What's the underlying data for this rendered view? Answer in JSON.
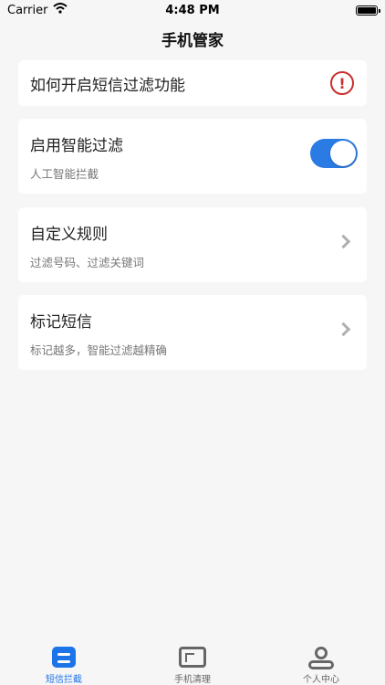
{
  "status_bar": {
    "carrier": "Carrier",
    "time": "4:48 PM"
  },
  "header": {
    "title": "手机管家"
  },
  "cards": [
    {
      "title": "如何开启短信过滤功能",
      "icon": "alert-circle-icon"
    },
    {
      "title": "启用智能过滤",
      "subtitle": "人工智能拦截",
      "toggle_on": true
    },
    {
      "title": "自定义规则",
      "subtitle": "过滤号码、过滤关键词"
    },
    {
      "title": "标记短信",
      "subtitle": "标记越多，智能过滤越精确"
    }
  ],
  "tabs": [
    {
      "label": "短信拦截",
      "icon": "message-filter-icon",
      "active": true
    },
    {
      "label": "手机清理",
      "icon": "phone-clean-icon",
      "active": false
    },
    {
      "label": "个人中心",
      "icon": "person-icon",
      "active": false
    }
  ],
  "colors": {
    "accent": "#2b7be4",
    "alert": "#c9302c",
    "background": "#f6f6f6"
  }
}
